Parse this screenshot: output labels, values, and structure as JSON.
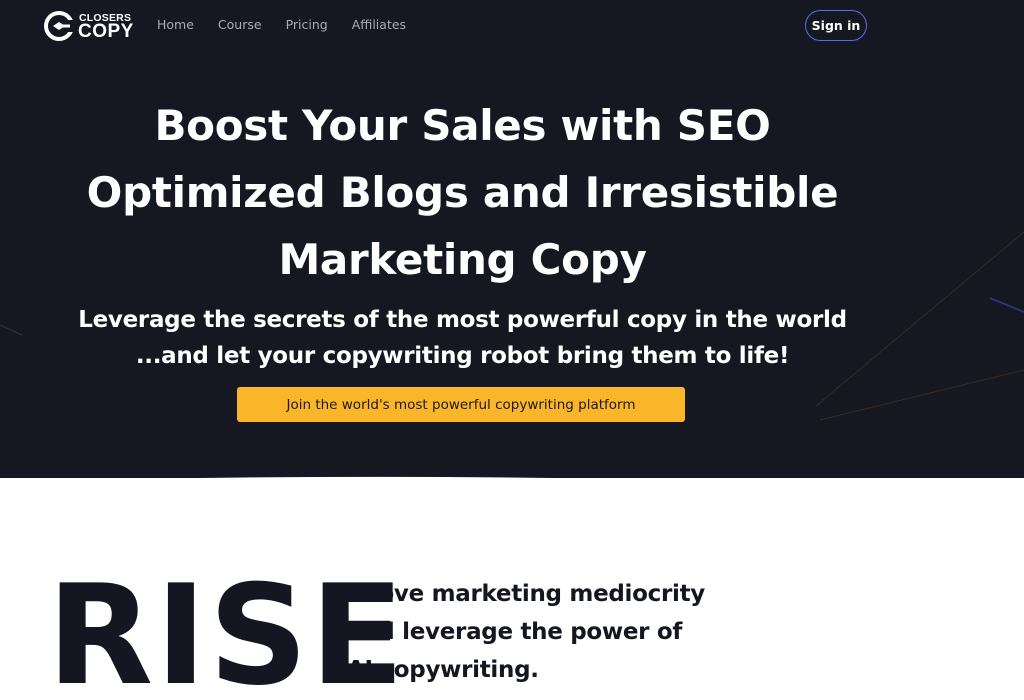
{
  "brand": {
    "logo_line1": "CLOSERS",
    "logo_line2": "COPY"
  },
  "nav": {
    "items": [
      {
        "label": "Home"
      },
      {
        "label": "Course"
      },
      {
        "label": "Pricing"
      },
      {
        "label": "Affiliates"
      }
    ],
    "signin_label": "Sign in"
  },
  "hero": {
    "headline_line1": "Boost Your Sales with SEO",
    "headline_line2": "Optimized Blogs and Irresistible",
    "headline_line3": "Marketing Copy",
    "subline_line1": "Leverage the secrets of the most powerful copy in the world",
    "subline_line2": "...and let your copywriting robot bring them to life!",
    "cta_label": "Join the world's most powerful copywriting platform"
  },
  "rise": {
    "big_word": "RISE",
    "line1": "above marketing mediocrity",
    "line2": "and leverage the power of",
    "line3": "AI copywriting."
  },
  "colors": {
    "hero_bg": "#151821",
    "cta_bg": "#fbb529",
    "signin_border": "#5b6cf2",
    "text_dark": "#141622"
  }
}
